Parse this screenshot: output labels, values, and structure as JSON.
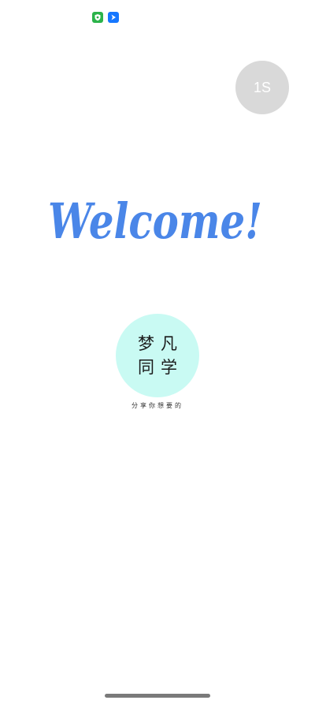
{
  "status_bar": {
    "icons": [
      "security-shield-icon",
      "navigation-app-icon"
    ]
  },
  "countdown": {
    "label": "1S"
  },
  "splash": {
    "welcome_text": "Welcome!",
    "logo_line_1": "梦凡",
    "logo_line_2": "同学",
    "tagline": "分享你想要的"
  },
  "colors": {
    "welcome": "#4a86e8",
    "logo_bg": "#c9faf3",
    "countdown_bg": "#d9d9d9"
  }
}
